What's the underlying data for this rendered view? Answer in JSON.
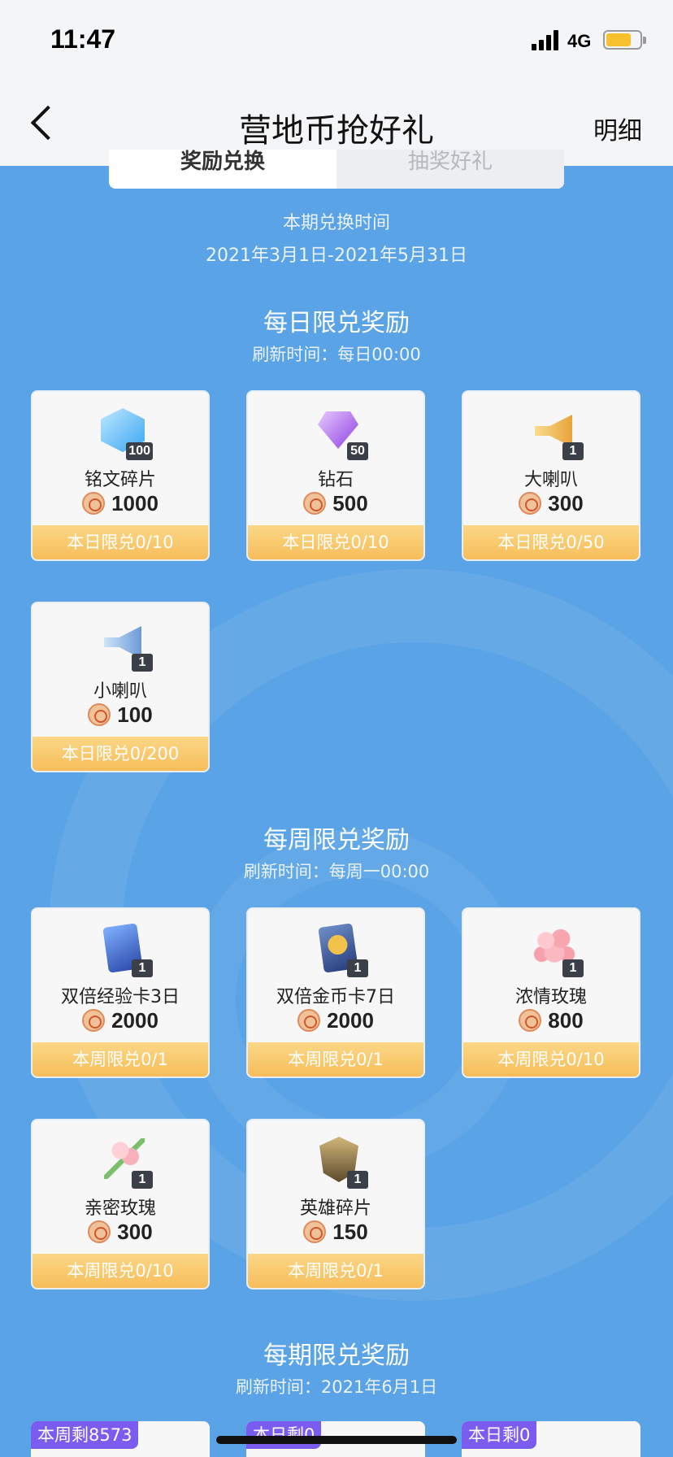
{
  "status_bar": {
    "time": "11:47",
    "network": "4G"
  },
  "nav": {
    "title": "营地币抢好礼",
    "detail_link": "明细"
  },
  "tabs": [
    {
      "label": "奖励兑换",
      "active": true
    },
    {
      "label": "抽奖好礼",
      "active": false
    }
  ],
  "period": {
    "label": "本期兑换时间",
    "range": "2021年3月1日-2021年5月31日"
  },
  "sections": {
    "daily": {
      "title": "每日限兑奖励",
      "refresh": "刷新时间：每日00:00",
      "items": [
        {
          "name": "铭文碎片",
          "qty": "100",
          "price": "1000",
          "limit": "本日限兑0/10",
          "icon": "crystal-icon"
        },
        {
          "name": "钻石",
          "qty": "50",
          "price": "500",
          "limit": "本日限兑0/10",
          "icon": "diamond-icon"
        },
        {
          "name": "大喇叭",
          "qty": "1",
          "price": "300",
          "limit": "本日限兑0/50",
          "icon": "big-horn-icon"
        },
        {
          "name": "小喇叭",
          "qty": "1",
          "price": "100",
          "limit": "本日限兑0/200",
          "icon": "small-horn-icon"
        }
      ]
    },
    "weekly": {
      "title": "每周限兑奖励",
      "refresh": "刷新时间：每周一00:00",
      "items": [
        {
          "name": "双倍经验卡3日",
          "qty": "1",
          "price": "2000",
          "limit": "本周限兑0/1",
          "icon": "exp-card-icon"
        },
        {
          "name": "双倍金币卡7日",
          "qty": "1",
          "price": "2000",
          "limit": "本周限兑0/1",
          "icon": "gold-card-icon"
        },
        {
          "name": "浓情玫瑰",
          "qty": "1",
          "price": "800",
          "limit": "本周限兑0/10",
          "icon": "roses-icon"
        },
        {
          "name": "亲密玫瑰",
          "qty": "1",
          "price": "300",
          "limit": "本周限兑0/10",
          "icon": "rose-bouquet-icon"
        },
        {
          "name": "英雄碎片",
          "qty": "1",
          "price": "150",
          "limit": "本周限兑0/1",
          "icon": "hero-fragment-icon"
        }
      ]
    },
    "period": {
      "title": "每期限兑奖励",
      "refresh": "刷新时间：2021年6月1日",
      "remain_tags": [
        "本周剩8573",
        "本日剩0",
        "本日剩0"
      ]
    }
  },
  "colors": {
    "background": "#5aa3e6",
    "limit_bar": "#f6bd5a",
    "remain_tag": "#7a5cf0"
  }
}
